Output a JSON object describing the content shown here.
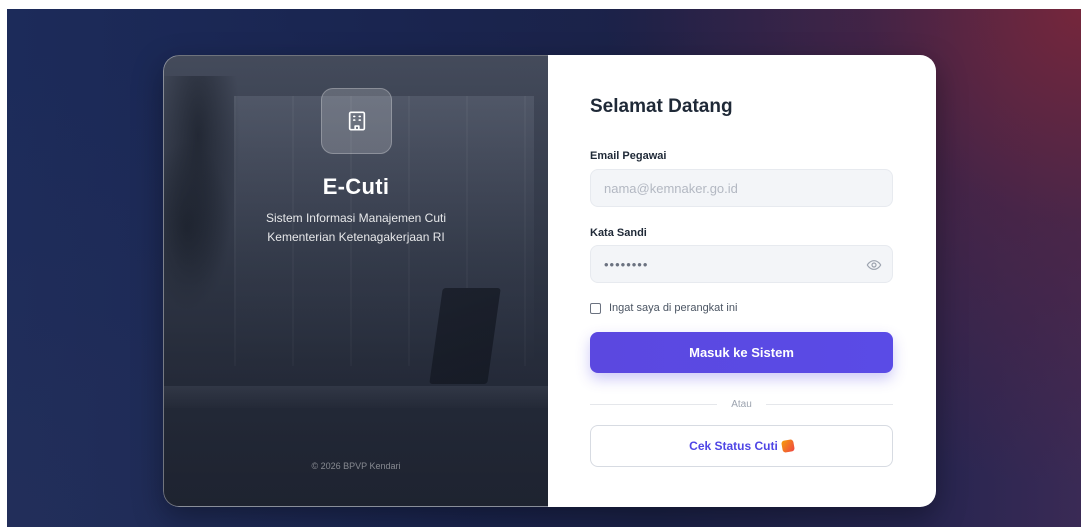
{
  "left_panel": {
    "brand": "E-Cuti",
    "subtitle_line1": "Sistem Informasi Manajemen Cuti",
    "subtitle_line2": "Kementerian Ketenagakerjaan RI",
    "copyright": "© 2026 BPVP Kendari",
    "logo_icon": "building-icon"
  },
  "form": {
    "title": "Selamat Datang",
    "email_label": "Email Pegawai",
    "email_placeholder": "nama@kemnaker.go.id",
    "email_value": "",
    "password_label": "Kata Sandi",
    "password_value": "••••••••",
    "password_toggle_icon": "eye-icon",
    "remember_label": "Ingat saya di perangkat ini",
    "remember_checked": false,
    "submit_label": "Masuk ke Sistem",
    "divider_text": "Atau",
    "status_label": "Cek Status Cuti"
  },
  "colors": {
    "accent": "#5b48e0",
    "link": "#4f46e5"
  }
}
